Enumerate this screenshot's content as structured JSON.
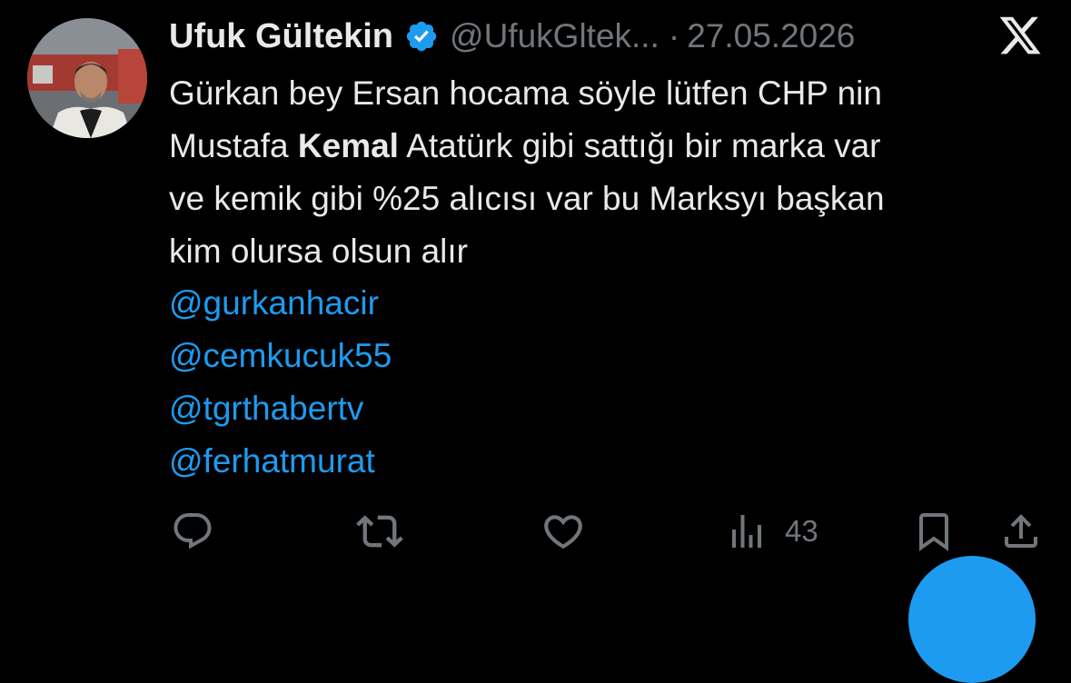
{
  "tweet": {
    "author": {
      "display_name": "Ufuk Gültekin",
      "handle": "@UfukGltek...",
      "verified": true
    },
    "separator": "·",
    "date": "27.05.2026",
    "text_lines": [
      "Gürkan bey Ersan hocama söyle lütfen CHP nin",
      [
        "Mustafa ",
        "Kemal",
        " Atatürk gibi sattığı bir marka var"
      ],
      "ve kemik gibi %25 alıcısı var bu Marksyı başkan",
      "kim olursa olsun alır"
    ],
    "line2": {
      "pre": "Mustafa ",
      "bold": "Kemal",
      "post": " Atatürk gibi sattığı bir marka var"
    },
    "mentions": [
      "@gurkanhacir",
      "@cemkucuk55",
      "@tgrthabertv",
      "@ferhatmurat"
    ],
    "actions": {
      "views_count": "43"
    }
  },
  "icons": {
    "verified": "verified-badge-icon",
    "brand": "x-logo-icon",
    "reply": "reply-icon",
    "retweet": "retweet-icon",
    "like": "heart-icon",
    "views": "views-bar-chart-icon",
    "bookmark": "bookmark-icon",
    "share": "share-icon"
  },
  "colors": {
    "background": "#000000",
    "text": "#e7e9ea",
    "muted": "#71767b",
    "accent": "#1d9bf0"
  }
}
